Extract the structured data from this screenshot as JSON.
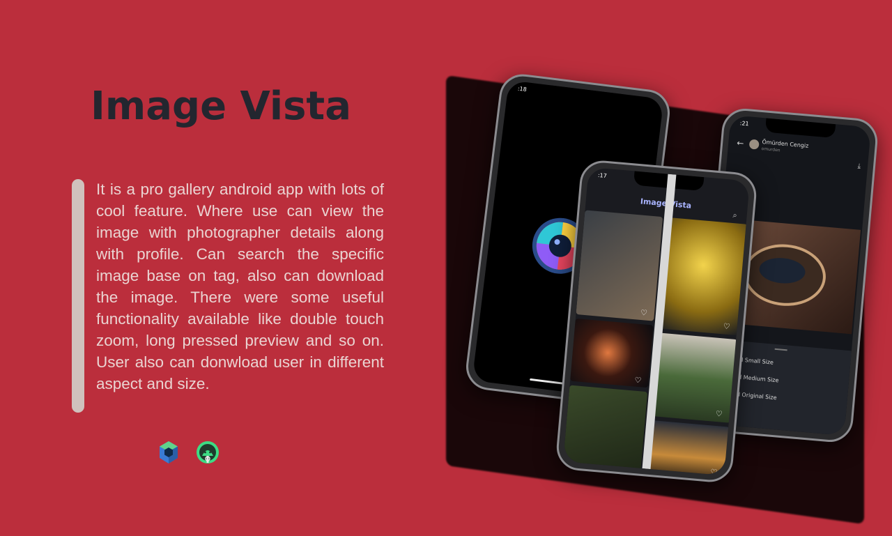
{
  "title": "Image Vista",
  "description": "It is a pro gallery android app with lots of cool feature. Where use can view the image with photographer details along with profile. Can search the specific image base on tag, also can download the image. There were some useful functionality available like double touch zoom, long pressed preview and so on. User also can donwload user in different aspect and size.",
  "tech_icons": [
    "jetpack-compose-icon",
    "android-studio-icon"
  ],
  "phones": {
    "splash": {
      "status_time": ":18"
    },
    "gallery": {
      "status_time": ":17",
      "app_title": "Image Vista"
    },
    "detail": {
      "status_time": ":21",
      "user_name": "Ömürden Cengiz",
      "user_handle": "omurden",
      "download_options": [
        "nload Small Size",
        "nload Medium Size",
        "nload Original Size"
      ]
    }
  },
  "colors": {
    "background": "#bb2e3c",
    "title": "#23262f",
    "text": "#ead4d2",
    "bar": "#d0c1bd"
  }
}
